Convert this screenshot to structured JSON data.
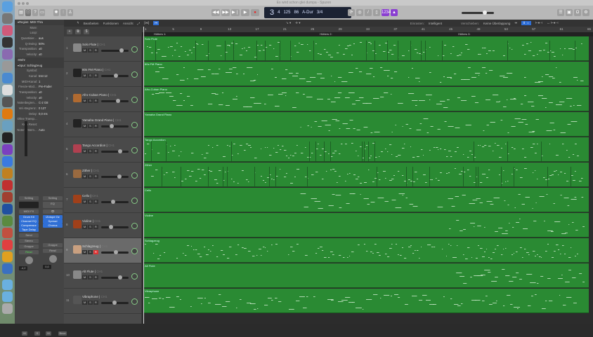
{
  "window": {
    "title": "Es wird schon glei dumpa - Spuren"
  },
  "dock": {
    "icons": [
      "finder-icon",
      "system-preferences-icon",
      "screens-icon",
      "script-icon",
      "preview-icon",
      "migration-icon",
      "imovie-icon",
      "textedit-icon",
      "dvd-player-icon",
      "vlc-icon",
      "photos-icon",
      "speaker-icon",
      "final-cut-icon",
      "instruments-icon",
      "gitarre-icon",
      "accessibility-icon",
      "calendar-icon",
      "bbedit-icon",
      "book-icon",
      "tools-icon",
      "fruit-icon",
      "photos-color-icon",
      "keynote-icon",
      "downloads-folder-icon",
      "applications-folder-icon",
      "trash-icon"
    ]
  },
  "transport": {
    "position_bar": "3",
    "position_beat": "4",
    "position_tick": "125",
    "tempo": "86",
    "key": "A-Dur",
    "signature": "3/4",
    "lcd_labels": [
      "Takt",
      "Beat",
      "Div",
      "Tick",
      "Tempo",
      "Tonart",
      "Takt"
    ]
  },
  "menu": {
    "edit": "Bearbeiten",
    "functions": "Funktionen",
    "view": "Ansicht",
    "snap_label": "Einrasten:",
    "snap_value": "Intelligent",
    "drag_label": "Verschieben:",
    "drag_value": "Keine Überlappung"
  },
  "inspector": {
    "region_header": "Region: MIDI Thru",
    "region_rows": [
      {
        "l": "Mute:",
        "v": ""
      },
      {
        "l": "Loop:",
        "v": ""
      },
      {
        "l": "Quantisier…",
        "v": "aus"
      },
      {
        "l": "Q-Swing:",
        "v": "50%"
      },
      {
        "l": "Transposition:",
        "v": "±0"
      },
      {
        "l": "Velocity:",
        "v": "±0"
      }
    ],
    "more": "Mehr",
    "track_header": "Spur: Schlagzeug",
    "track_rows": [
      {
        "l": "Symbol:",
        "v": ""
      },
      {
        "l": "Kanal:",
        "v": "Inst 12"
      },
      {
        "l": "MIDI-Kanal:",
        "v": "1"
      },
      {
        "l": "Freeze-Mod…",
        "v": "Pre-Fader"
      },
      {
        "l": "Transposition:",
        "v": "±0"
      },
      {
        "l": "Velocity:",
        "v": "±0"
      },
      {
        "l": "Notenbegren…",
        "v": "C-2   G8"
      },
      {
        "l": "Vel.-Begrenz.:",
        "v": "0   127"
      },
      {
        "l": "Delay:",
        "v": "0,0 ms"
      },
      {
        "l": "Ohne Transp…",
        "v": ""
      },
      {
        "l": "Kein Reset:",
        "v": ""
      },
      {
        "l": "Notensystem…",
        "v": "Auto"
      }
    ],
    "strip1": {
      "setting": "Setting",
      "midi_fx": "MIDI FX",
      "plugins": [
        "Drum Kit",
        "Channel EQ",
        "Compressor",
        "Tape Delay"
      ],
      "send": "Send",
      "output": "Stereo",
      "group": "Gruppe",
      "automation": "Read",
      "volume": "-4,2",
      "mute": "M",
      "solo": "S"
    },
    "strip2": {
      "setting": "Setting",
      "eq": "EQ",
      "plugins": [
        "iZotope Oz",
        "Spread",
        "Chorus"
      ],
      "group": "Gruppe",
      "automation": "Read",
      "volume": "0,0",
      "mute": "M",
      "name": "Bnce"
    }
  },
  "ruler": {
    "bars": [
      "1",
      "5",
      "9",
      "13",
      "17",
      "21",
      "25",
      "29",
      "33",
      "37",
      "41",
      "45",
      "49",
      "53",
      "57",
      "61",
      "65"
    ],
    "markers": [
      "Hütters 1:",
      "Hütters 2:",
      "Hütters 3:"
    ]
  },
  "tracks": [
    {
      "num": "1",
      "name": "Solo Flute",
      "ch": "CH1",
      "icon": "flute-icon",
      "vol": 0.8,
      "color": "#888"
    },
    {
      "num": "2",
      "name": "80s FM Piano",
      "ch": "CH1",
      "icon": "keyboard-stand-icon",
      "vol": 0.55,
      "color": "#222"
    },
    {
      "num": "3",
      "name": "Afro-Cuban Piano",
      "ch": "CH1",
      "icon": "upright-piano-icon",
      "vol": 0.65,
      "color": "#b06a30"
    },
    {
      "num": "4",
      "name": "Yamaha Grand Piano",
      "ch": "CH1",
      "icon": "grand-piano-icon",
      "vol": 0.37,
      "color": "#222"
    },
    {
      "num": "5",
      "name": "Tango Accordion",
      "ch": "CH1",
      "icon": "accordion-icon",
      "vol": 0.73,
      "color": "#b04050"
    },
    {
      "num": "6",
      "name": "Zither",
      "ch": "CH1",
      "icon": "zither-icon",
      "vol": 0.7,
      "color": "#9a6a40"
    },
    {
      "num": "7",
      "name": "Cello",
      "ch": "CH1",
      "icon": "strings-icon",
      "vol": 0.42,
      "color": "#a0401a"
    },
    {
      "num": "8",
      "name": "Violine",
      "ch": "CH1",
      "icon": "strings-icon",
      "vol": 0.33,
      "color": "#a0401a"
    },
    {
      "num": "9",
      "name": "Schlagzeug",
      "ch": "CH1",
      "icon": "drum-kit-icon",
      "vol": 0.55,
      "color": "#c9a080",
      "selected": true,
      "record": true
    },
    {
      "num": "10",
      "name": "Alt Flute",
      "ch": "CH1",
      "icon": "flute-icon",
      "vol": 0.72,
      "color": "#888"
    },
    {
      "num": "11",
      "name": "Vibraphone",
      "ch": "CH1",
      "icon": "vibraphone-icon",
      "vol": 0.47,
      "color": "#555"
    }
  ],
  "track_buttons": {
    "mute": "M",
    "solo": "S",
    "record": "R"
  },
  "colors": {
    "region": "#2a8a33",
    "accent": "#2f6fd6",
    "record": "#dd3333",
    "lcd": "#1b2233"
  }
}
